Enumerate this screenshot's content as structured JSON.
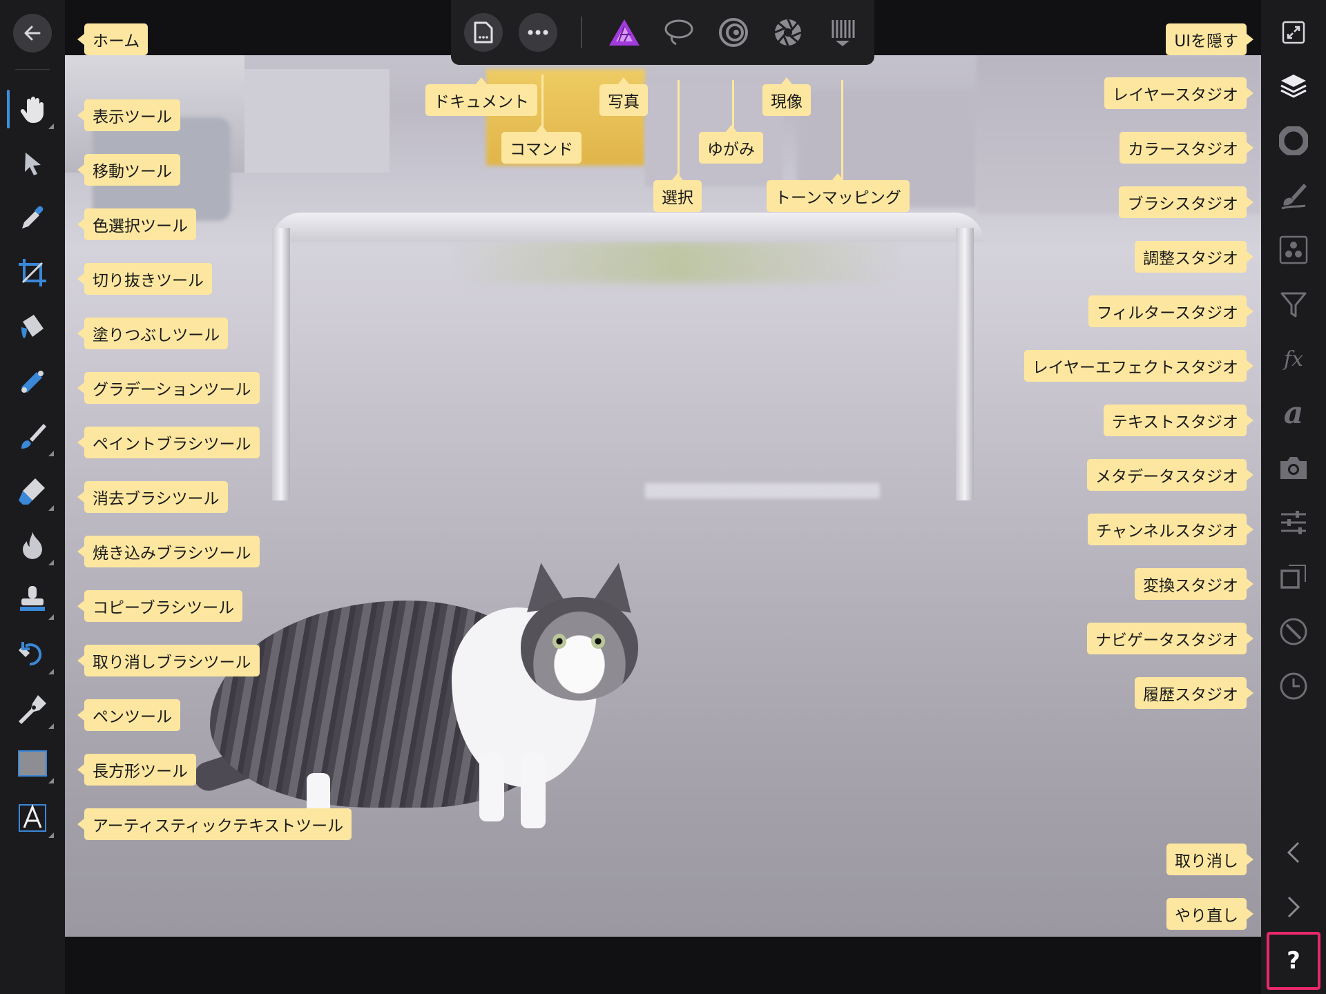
{
  "canvas": {
    "description_hidden": ""
  },
  "left_toolbar": {
    "back_icon": "arrow-left-icon",
    "tools": [
      {
        "key": "view",
        "icon": "hand-icon",
        "label": "表示ツール",
        "active": true
      },
      {
        "key": "move",
        "icon": "pointer-icon",
        "label": "移動ツール"
      },
      {
        "key": "color-picker",
        "icon": "eyedropper-icon",
        "label": "色選択ツール"
      },
      {
        "key": "crop",
        "icon": "crop-icon",
        "label": "切り抜きツール"
      },
      {
        "key": "fill",
        "icon": "paint-bucket-icon",
        "label": "塗りつぶしツール"
      },
      {
        "key": "gradient",
        "icon": "gradient-icon",
        "label": "グラデーションツール"
      },
      {
        "key": "paint-brush",
        "icon": "brush-icon",
        "label": "ペイントブラシツール"
      },
      {
        "key": "erase-brush",
        "icon": "eraser-icon",
        "label": "消去ブラシツール"
      },
      {
        "key": "burn-brush",
        "icon": "flame-icon",
        "label": "焼き込みブラシツール"
      },
      {
        "key": "clone-brush",
        "icon": "stamp-icon",
        "label": "コピーブラシツール"
      },
      {
        "key": "undo-brush",
        "icon": "undo-brush-icon",
        "label": "取り消しブラシツール"
      },
      {
        "key": "pen",
        "icon": "pen-nib-icon",
        "label": "ペンツール"
      },
      {
        "key": "rectangle",
        "icon": "rectangle-icon",
        "label": "長方形ツール"
      },
      {
        "key": "artistic-text",
        "icon": "text-a-icon",
        "label": "アーティスティックテキストツール"
      }
    ]
  },
  "labels": {
    "home": "ホーム",
    "hide_ui": "UIを隠す",
    "document": "ドキュメント",
    "command": "コマンド",
    "photo": "写真",
    "selection": "選択",
    "liquify": "ゆがみ",
    "develop": "現像",
    "tone_mapping": "トーンマッピング",
    "undo": "取り消し",
    "redo": "やり直し"
  },
  "top_toolbar": {
    "document_icon": "document-icon",
    "more_icon": "ellipsis-icon",
    "personas": [
      {
        "key": "photo",
        "icon": "affinity-photo-triangle-icon",
        "color": "#a23bdc"
      },
      {
        "key": "selection",
        "icon": "lasso-icon"
      },
      {
        "key": "liquify",
        "icon": "liquify-swirl-icon"
      },
      {
        "key": "develop",
        "icon": "aperture-icon"
      },
      {
        "key": "tone-mapping",
        "icon": "tone-mapping-icon"
      }
    ]
  },
  "right_panel": {
    "hide_ui_icon": "fullscreen-icon",
    "studios": [
      {
        "key": "layers",
        "icon": "layers-icon",
        "label": "レイヤースタジオ"
      },
      {
        "key": "color",
        "icon": "color-wheel-icon",
        "label": "カラースタジオ"
      },
      {
        "key": "brushes",
        "icon": "brush-stroke-icon",
        "label": "ブラシスタジオ"
      },
      {
        "key": "adjustments",
        "icon": "adjustment-dots-icon",
        "label": "調整スタジオ"
      },
      {
        "key": "filters",
        "icon": "funnel-icon",
        "label": "フィルタースタジオ"
      },
      {
        "key": "layer-effects",
        "icon": "fx-icon",
        "label": "レイヤーエフェクトスタジオ",
        "glyph": "fx"
      },
      {
        "key": "text",
        "icon": "text-icon",
        "label": "テキストスタジオ",
        "glyph": "a"
      },
      {
        "key": "metadata",
        "icon": "camera-icon",
        "label": "メタデータスタジオ"
      },
      {
        "key": "channels",
        "icon": "sliders-icon",
        "label": "チャンネルスタジオ"
      },
      {
        "key": "transform",
        "icon": "transform-icon",
        "label": "変換スタジオ"
      },
      {
        "key": "navigator",
        "icon": "compass-icon",
        "label": "ナビゲータスタジオ"
      },
      {
        "key": "history",
        "icon": "clock-icon",
        "label": "履歴スタジオ"
      }
    ],
    "undo_icon": "chevron-left-icon",
    "redo_icon": "chevron-right-icon",
    "help_icon": "help-icon",
    "help_glyph": "?",
    "help_highlight_color": "#e8286a"
  },
  "colors": {
    "accent": "#3d8fd9",
    "label_bg": "#fde7a0",
    "panel_bg": "#1b1b1e"
  }
}
